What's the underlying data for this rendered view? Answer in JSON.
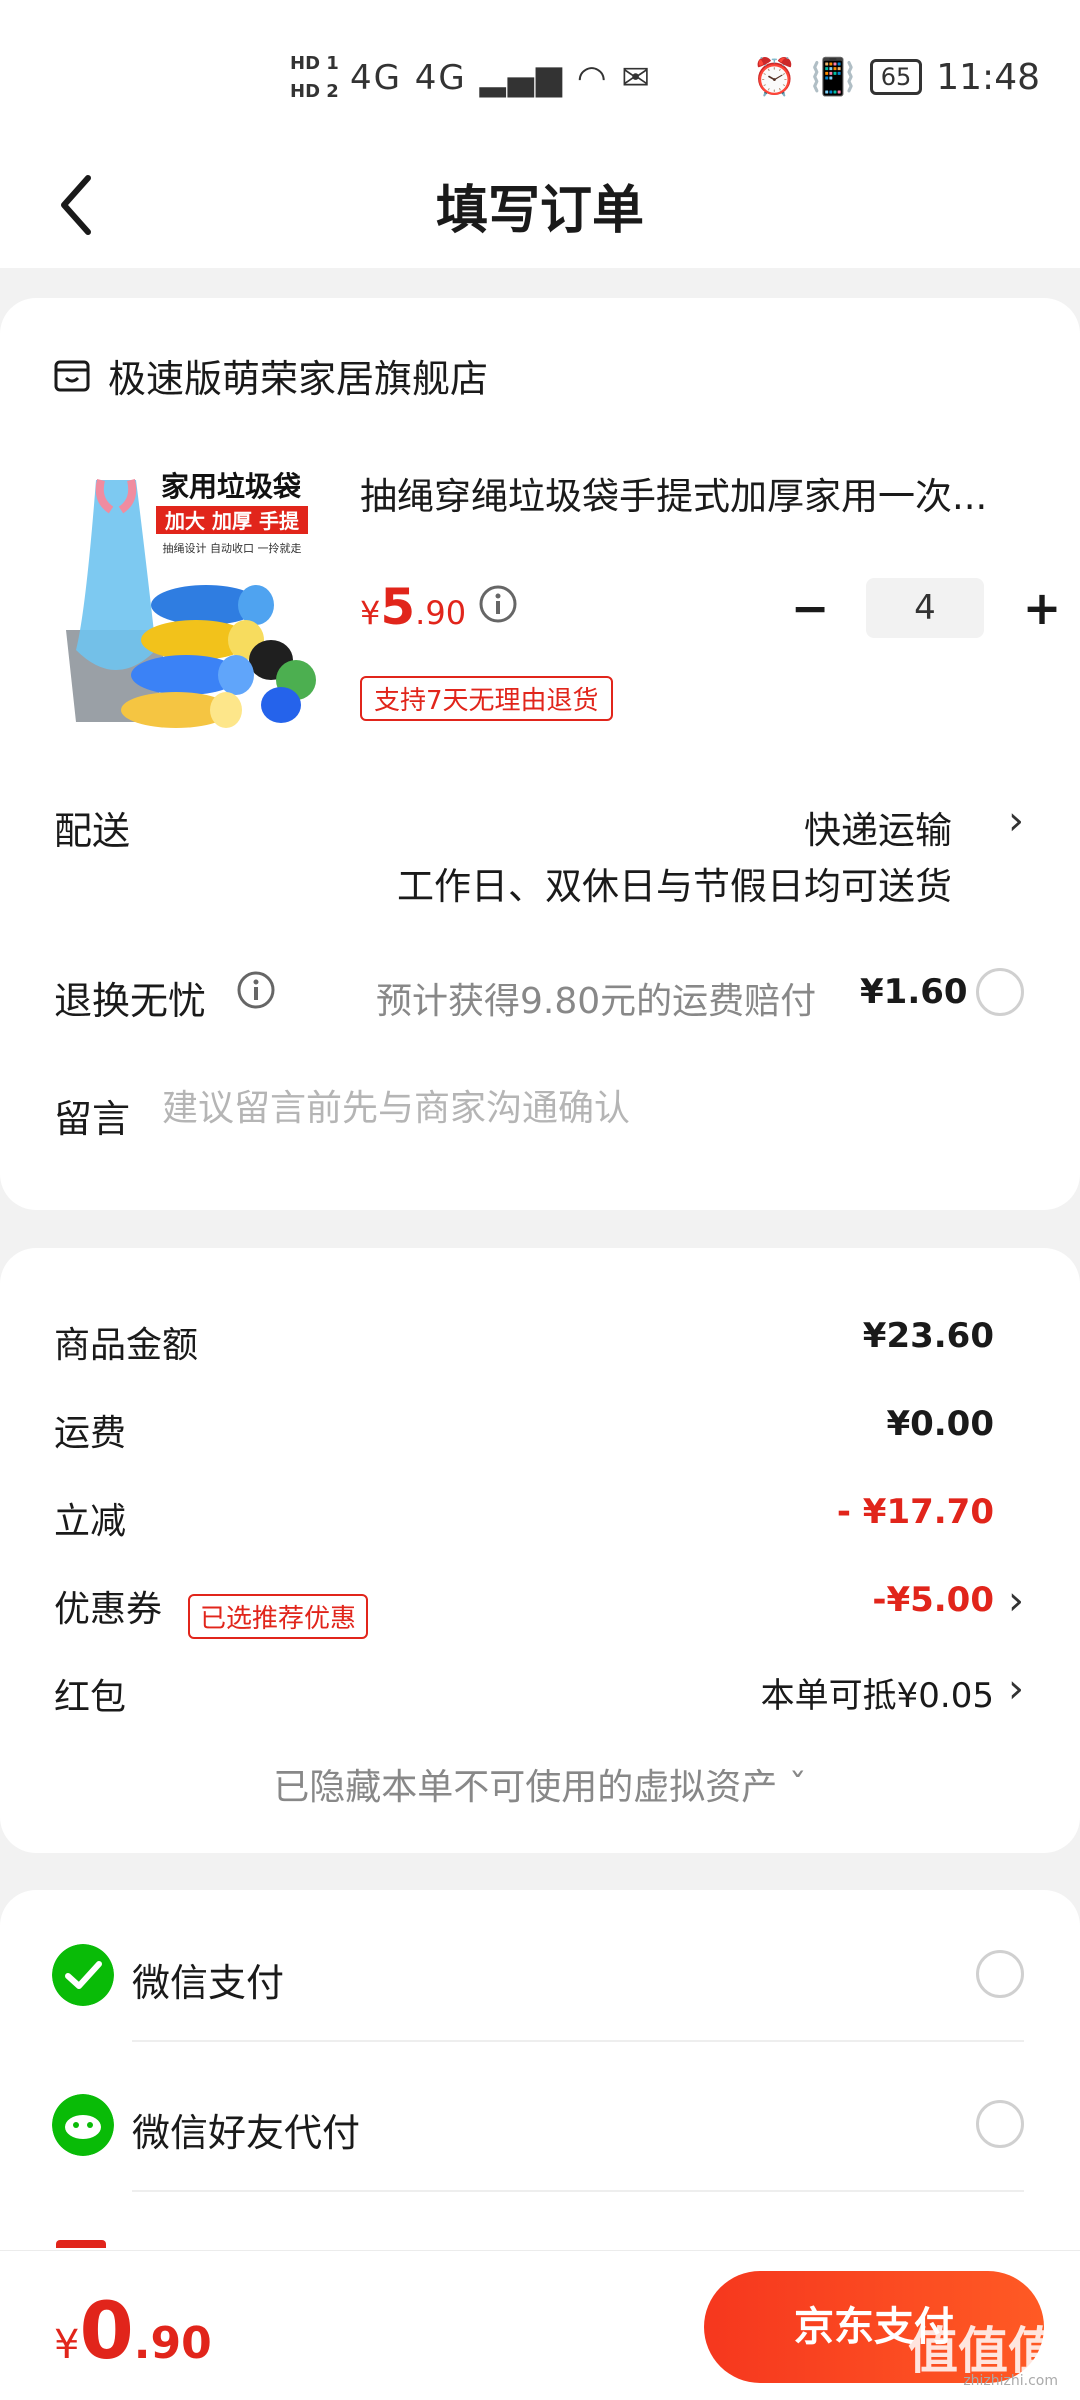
{
  "status_bar": {
    "hd1": "HD 1",
    "hd2": "HD 2",
    "signal": "4G 4G",
    "battery": "65",
    "time": "11:48"
  },
  "nav": {
    "title": "填写订单"
  },
  "shop": {
    "name": "极速版萌荣家居旗舰店"
  },
  "product": {
    "image_texts": {
      "headline": "家用垃圾袋",
      "tags": "加大 加厚 手提",
      "sub": "抽绳设计 自动收口 一拎就走"
    },
    "title": "抽绳穿绳垃圾袋手提式加厚家用一次...",
    "price_symbol": "¥",
    "price_int": "5",
    "price_dec": ".90",
    "quantity": "4",
    "minus": "−",
    "plus": "+",
    "return_tag": "支持7天无理由退货"
  },
  "delivery": {
    "label": "配送",
    "value": "快递运输",
    "note": "工作日、双休日与节假日均可送货"
  },
  "worry_free": {
    "label": "退换无忧",
    "text": "预计获得9.80元的运费赔付",
    "price": "¥1.60"
  },
  "message": {
    "label": "留言",
    "placeholder": "建议留言前先与商家沟通确认"
  },
  "fees": {
    "goods_label": "商品金额",
    "goods_value": "¥23.60",
    "shipping_label": "运费",
    "shipping_value": "¥0.00",
    "discount_label": "立减",
    "discount_value": "- ¥17.70",
    "coupon_label": "优惠券",
    "coupon_tag": "已选推荐优惠",
    "coupon_value": "-¥5.00",
    "redpacket_label": "红包",
    "redpacket_value": "本单可抵¥0.05",
    "hidden_assets": "已隐藏本单不可使用的虚拟资产 ˇ"
  },
  "payment": {
    "wechat_pay": "微信支付",
    "wechat_friend_pay": "微信好友代付"
  },
  "bottom": {
    "total_symbol": "¥",
    "total_int": "0",
    "total_dec": ".90",
    "pay_button": "京东支付",
    "watermark": "值值值",
    "watermark_sub": "zhizhizhi.com"
  },
  "colors": {
    "accent": "#e1251b",
    "wechat": "#09bb07"
  }
}
